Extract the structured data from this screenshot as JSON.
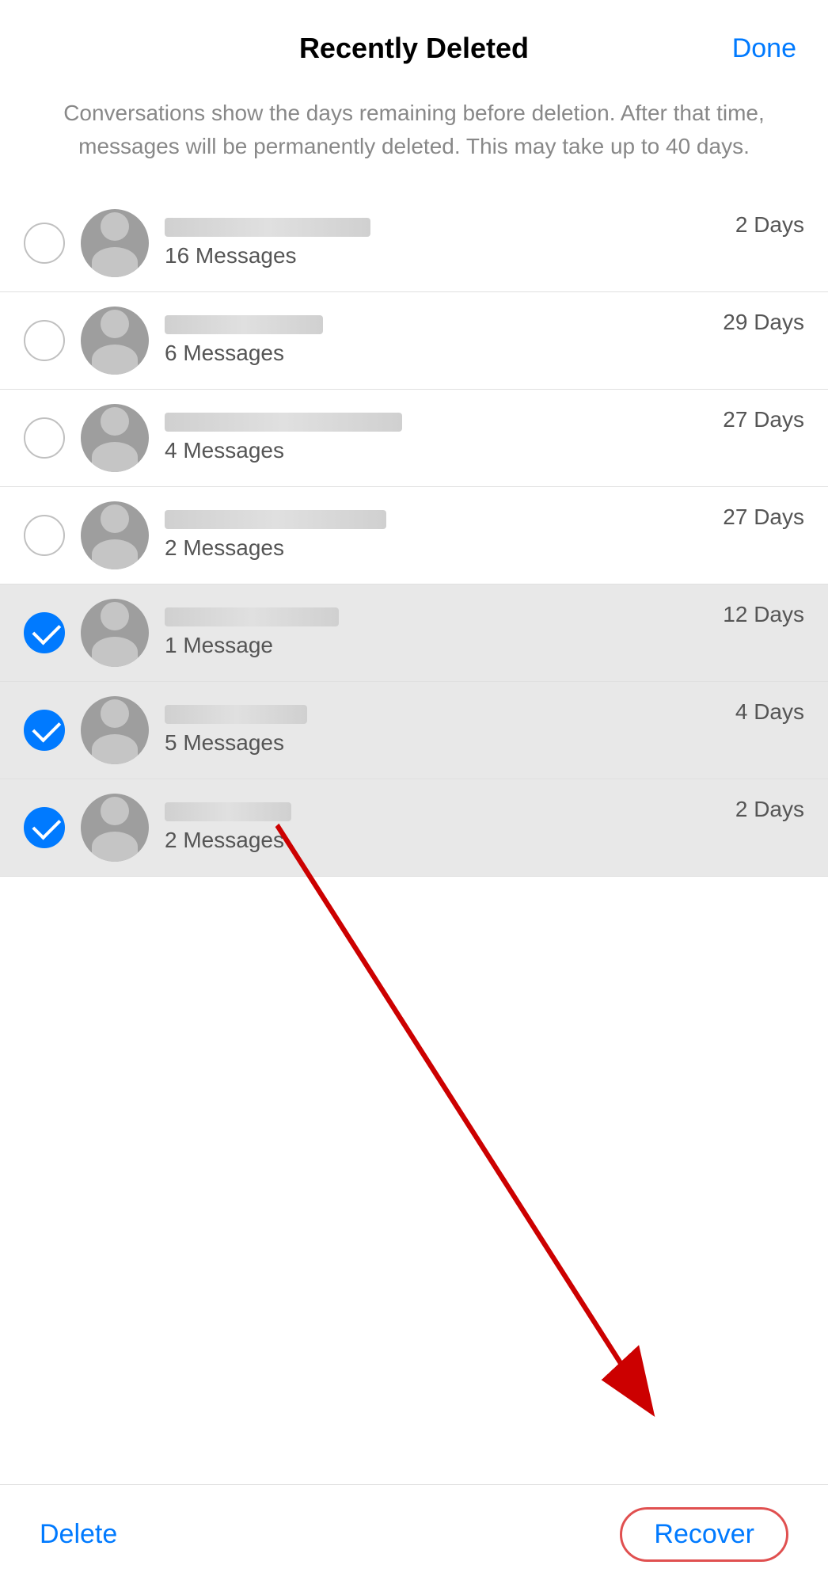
{
  "header": {
    "title": "Recently Deleted",
    "done_label": "Done"
  },
  "description": {
    "text": "Conversations show the days remaining before deletion. After that time, messages will be permanently deleted. This may take up to 40 days."
  },
  "conversations": [
    {
      "id": 1,
      "selected": false,
      "messages_label": "16 Messages",
      "days_label": "2 Days"
    },
    {
      "id": 2,
      "selected": false,
      "messages_label": "6 Messages",
      "days_label": "29 Days"
    },
    {
      "id": 3,
      "selected": false,
      "messages_label": "4 Messages",
      "days_label": "27 Days"
    },
    {
      "id": 4,
      "selected": false,
      "messages_label": "2 Messages",
      "days_label": "27 Days"
    },
    {
      "id": 5,
      "selected": true,
      "messages_label": "1 Message",
      "days_label": "12 Days"
    },
    {
      "id": 6,
      "selected": true,
      "messages_label": "5 Messages",
      "days_label": "4 Days"
    },
    {
      "id": 7,
      "selected": true,
      "messages_label": "2 Messages",
      "days_label": "2 Days"
    }
  ],
  "toolbar": {
    "delete_label": "Delete",
    "recover_label": "Recover"
  }
}
